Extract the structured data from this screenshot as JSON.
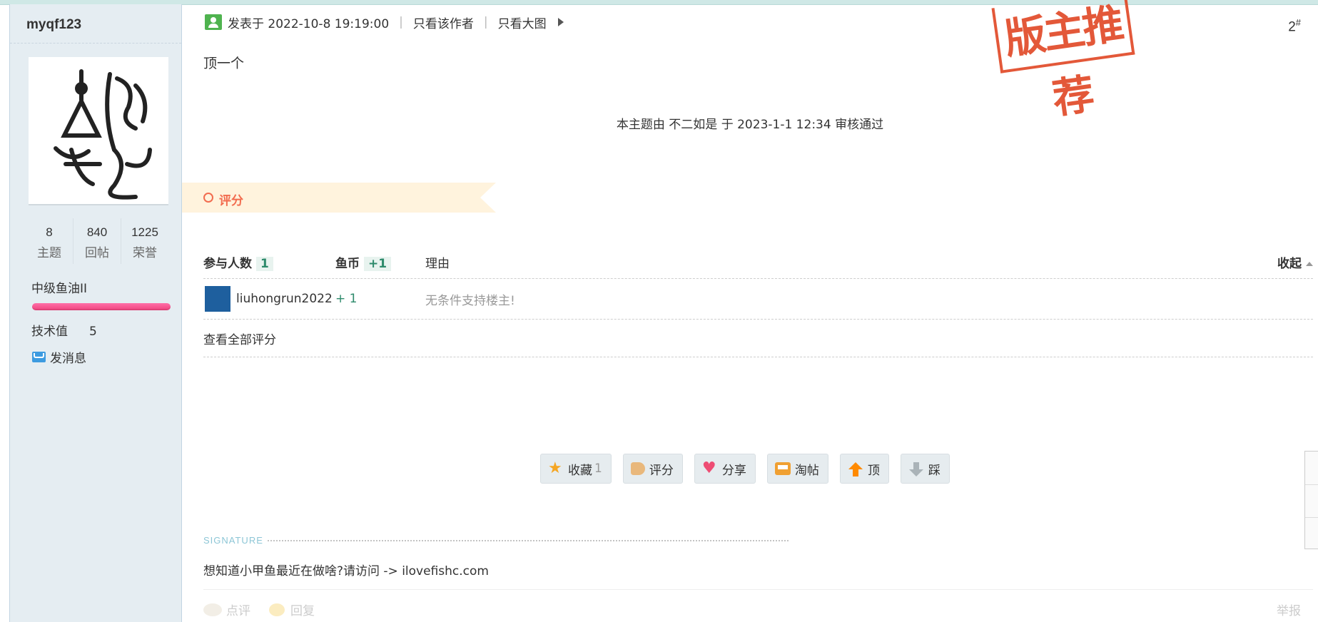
{
  "sidebar": {
    "username": "myqf123",
    "stats": [
      {
        "value": "8",
        "label": "主题"
      },
      {
        "value": "840",
        "label": "回帖"
      },
      {
        "value": "1225",
        "label": "荣誉"
      }
    ],
    "rank": "中级鱼油II",
    "tech_label": "技术值",
    "tech_value": "5",
    "message_label": "发消息"
  },
  "post": {
    "posted_label": "发表于 2022-10-8 19:19:00",
    "author_only": "只看该作者",
    "big_image_only": "只看大图",
    "floor": "2",
    "floor_mark": "#",
    "stamp_text": "版主推荐",
    "body": "顶一个",
    "review_note": "本主题由 不二如是 于 2023-1-1 12:34 审核通过"
  },
  "rating": {
    "title": "评分",
    "participants_label": "参与人数",
    "participants_count": "1",
    "coin_label": "鱼币",
    "coin_total": "+1",
    "reason_label": "理由",
    "collapse_label": "收起",
    "rows": [
      {
        "user": "liuhongrun2022",
        "coins": "+ 1",
        "reason": "无条件支持楼主!"
      }
    ],
    "view_all": "查看全部评分"
  },
  "actions": {
    "favorite": "收藏",
    "favorite_count": "1",
    "rate": "评分",
    "share": "分享",
    "tao": "淘帖",
    "up": "顶",
    "down": "踩"
  },
  "signature": {
    "label": "SIGNATURE",
    "text": "想知道小甲鱼最近在做啥?请访问 -> ilovefishc.com"
  },
  "footer": {
    "comment": "点评",
    "reply": "回复",
    "report": "举报"
  }
}
